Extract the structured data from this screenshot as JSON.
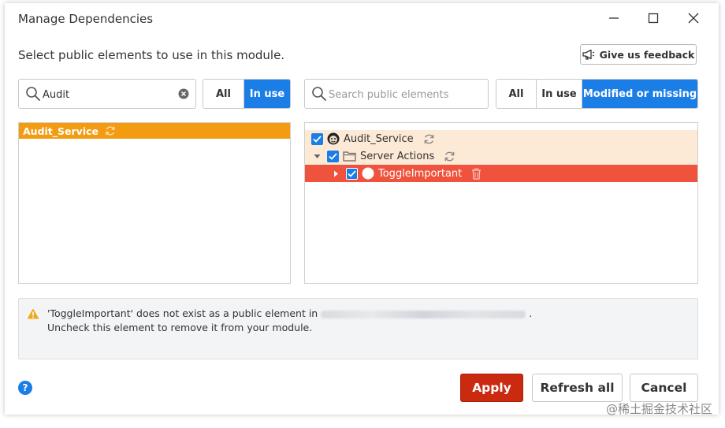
{
  "dialog": {
    "title": "Manage Dependencies",
    "instruction": "Select public elements to use in this module.",
    "feedback_label": "Give us feedback"
  },
  "left": {
    "search_value": "Audit",
    "filters": [
      "All",
      "In use"
    ],
    "active_filter": "In use",
    "modules": [
      {
        "name": "Audit_Service",
        "selected": true
      }
    ]
  },
  "right": {
    "search_placeholder": "Search public elements",
    "filters": [
      "All",
      "In use",
      "Modified or missing"
    ],
    "active_filter": "Modified or missing",
    "tree": {
      "module": "Audit_Service",
      "folder": "Server Actions",
      "action": "ToggleImportant"
    }
  },
  "warning": {
    "line1_prefix": "'ToggleImportant' does not exist as a public element in",
    "line1_suffix": ".",
    "line2": "Uncheck this element to remove it from your module."
  },
  "help_label": "?",
  "buttons": {
    "apply": "Apply",
    "refresh_all": "Refresh all",
    "cancel": "Cancel"
  },
  "watermark": "@稀土掘金技术社区",
  "colors": {
    "accent_blue": "#1a7ee6",
    "selected_orange": "#f39c12",
    "missing_red": "#f0533d",
    "modified_peach": "#fce9d6",
    "apply_red": "#c92a10"
  }
}
